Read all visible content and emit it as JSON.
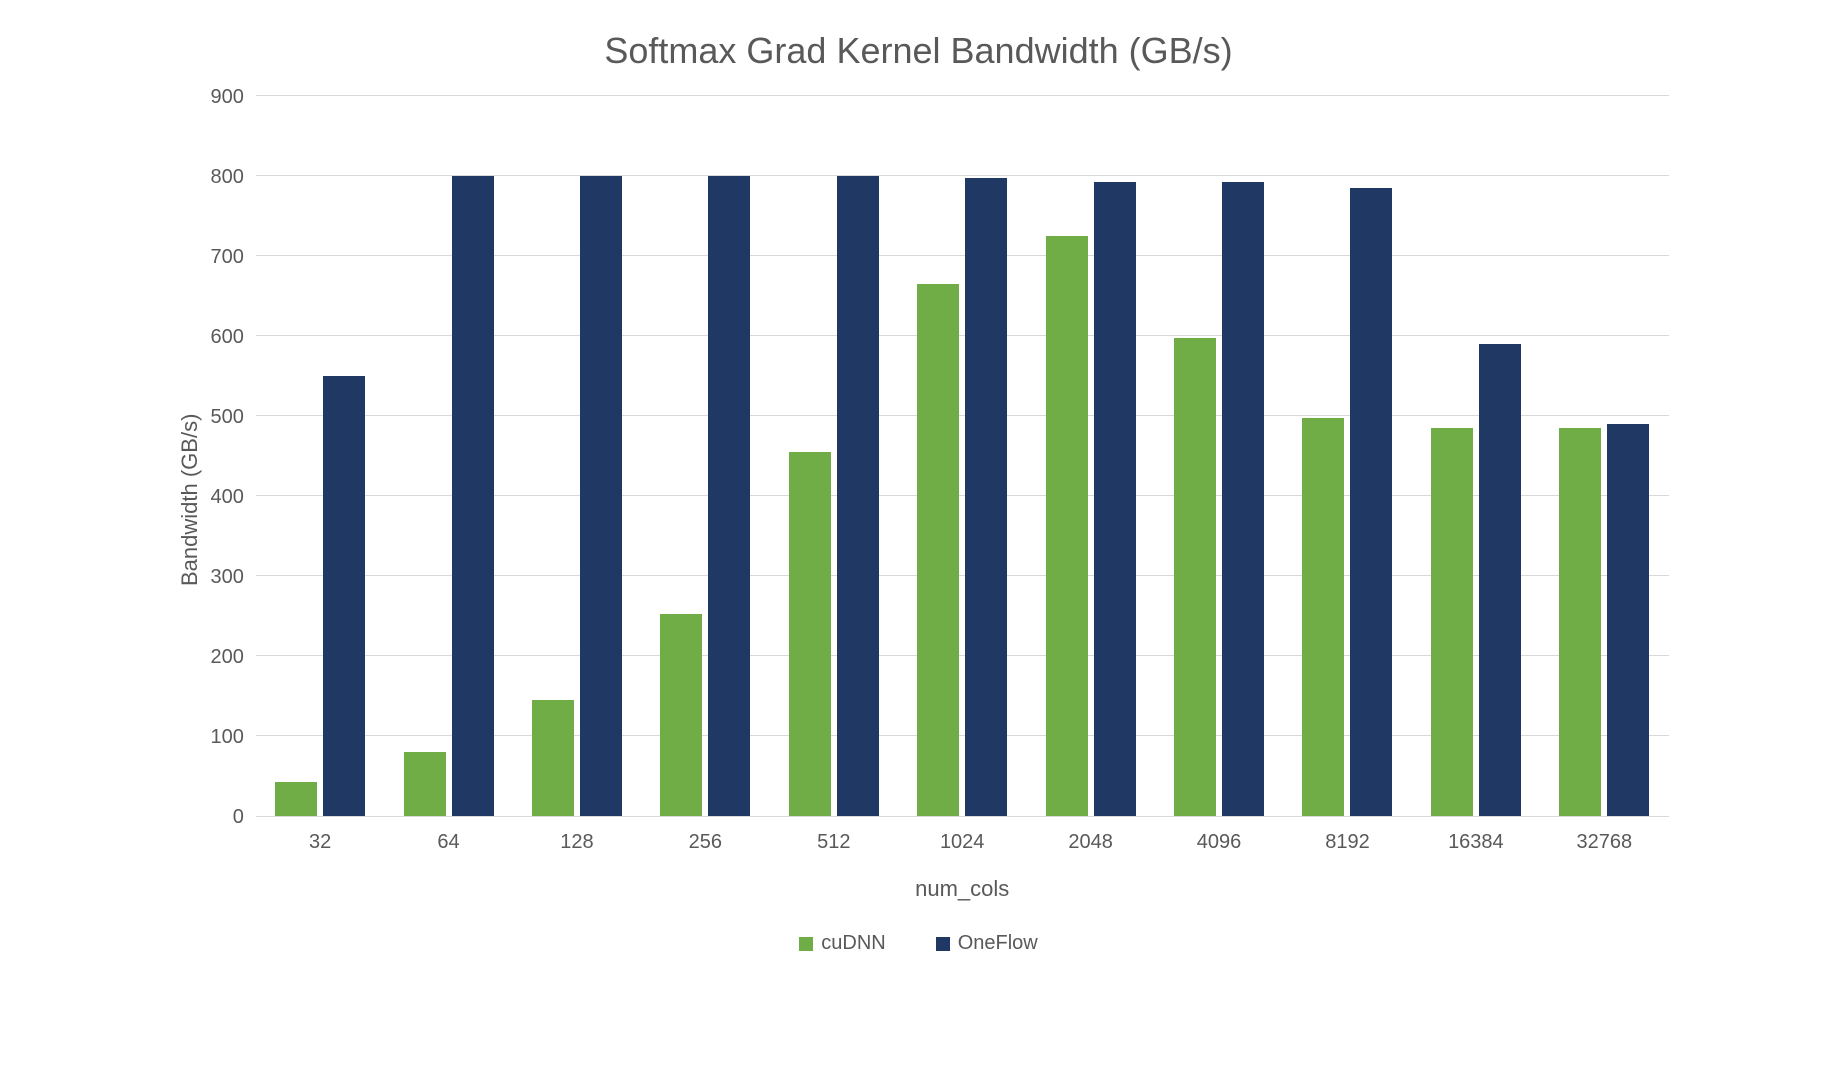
{
  "chart_data": {
    "type": "bar",
    "title": "Softmax Grad Kernel Bandwidth (GB/s)",
    "xlabel": "num_cols",
    "ylabel": "Bandwidth (GB/s)",
    "ylim": [
      0,
      900
    ],
    "yticks": [
      0,
      100,
      200,
      300,
      400,
      500,
      600,
      700,
      800,
      900
    ],
    "categories": [
      "32",
      "64",
      "128",
      "256",
      "512",
      "1024",
      "2048",
      "4096",
      "8192",
      "16384",
      "32768"
    ],
    "series": [
      {
        "name": "cuDNN",
        "color": "#70ad47",
        "values": [
          42,
          80,
          145,
          252,
          455,
          665,
          725,
          598,
          498,
          485,
          485
        ]
      },
      {
        "name": "OneFlow",
        "color": "#1f3864",
        "values": [
          550,
          800,
          800,
          800,
          800,
          797,
          793,
          793,
          785,
          590,
          490
        ]
      }
    ],
    "legend_position": "bottom",
    "grid": true
  }
}
